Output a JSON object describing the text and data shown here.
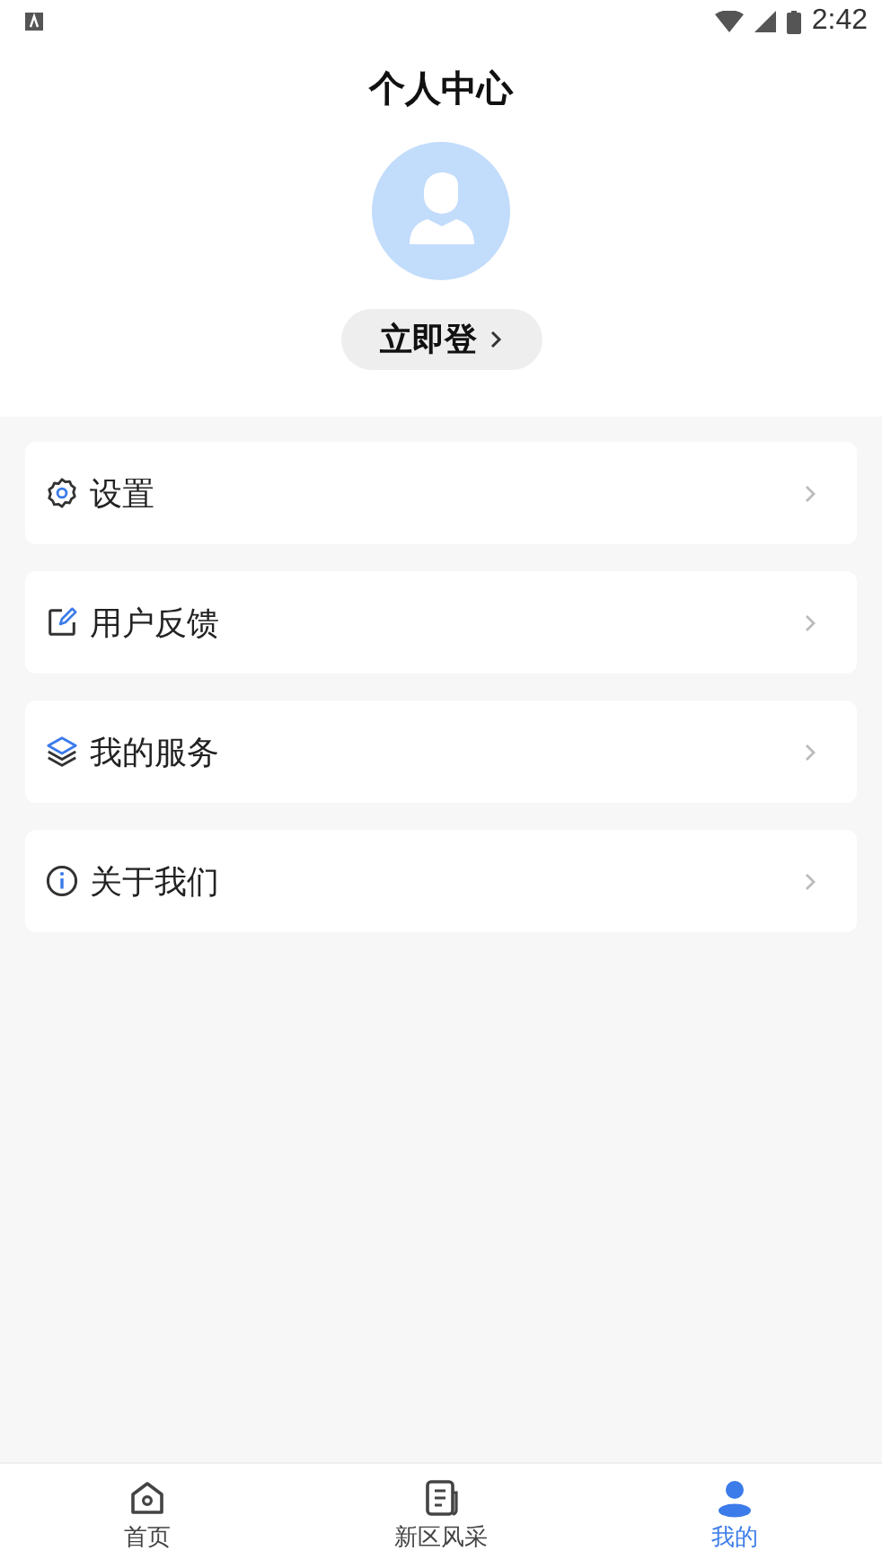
{
  "status_bar": {
    "time": "2:42"
  },
  "header": {
    "title": "个人中心",
    "login_button": {
      "label": "立即登"
    }
  },
  "menu": [
    {
      "label": "设置",
      "kind": "gear"
    },
    {
      "label": "用户反馈",
      "kind": "edit"
    },
    {
      "label": "我的服务",
      "kind": "layers"
    },
    {
      "label": "关于我们",
      "kind": "info"
    }
  ],
  "tab_bar": [
    {
      "label": "首页",
      "kind": "home",
      "selected": false
    },
    {
      "label": "新区风采",
      "kind": "doc",
      "selected": false
    },
    {
      "label": "我的",
      "kind": "person",
      "selected": true
    }
  ]
}
